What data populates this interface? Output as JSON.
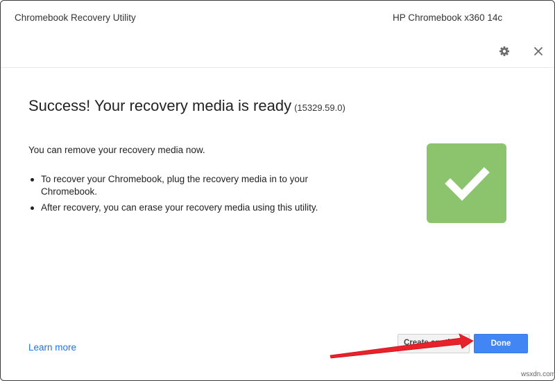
{
  "window": {
    "app_title": "Chromebook Recovery Utility",
    "device_name": "HP Chromebook x360 14c"
  },
  "icons": {
    "settings": "gear-icon",
    "close": "close-icon",
    "status": "checkmark-icon",
    "annotation": "red-arrow-icon"
  },
  "content": {
    "headline": "Success! Your recovery media is ready",
    "version": "(15329.59.0)",
    "lead": "You can remove your recovery media now.",
    "steps": [
      "To recover your Chromebook, plug the recovery media in to your Chromebook.",
      "After recovery, you can erase your recovery media using this utility."
    ]
  },
  "footer": {
    "learn_more": "Learn more",
    "create_another_label": "Create another",
    "done_label": "Done"
  },
  "watermark": "wsxdn.com",
  "colors": {
    "success_green": "#8bc46d",
    "primary_blue": "#4285f4",
    "link_blue": "#1a73e8",
    "annotation_red": "#e8222a"
  }
}
